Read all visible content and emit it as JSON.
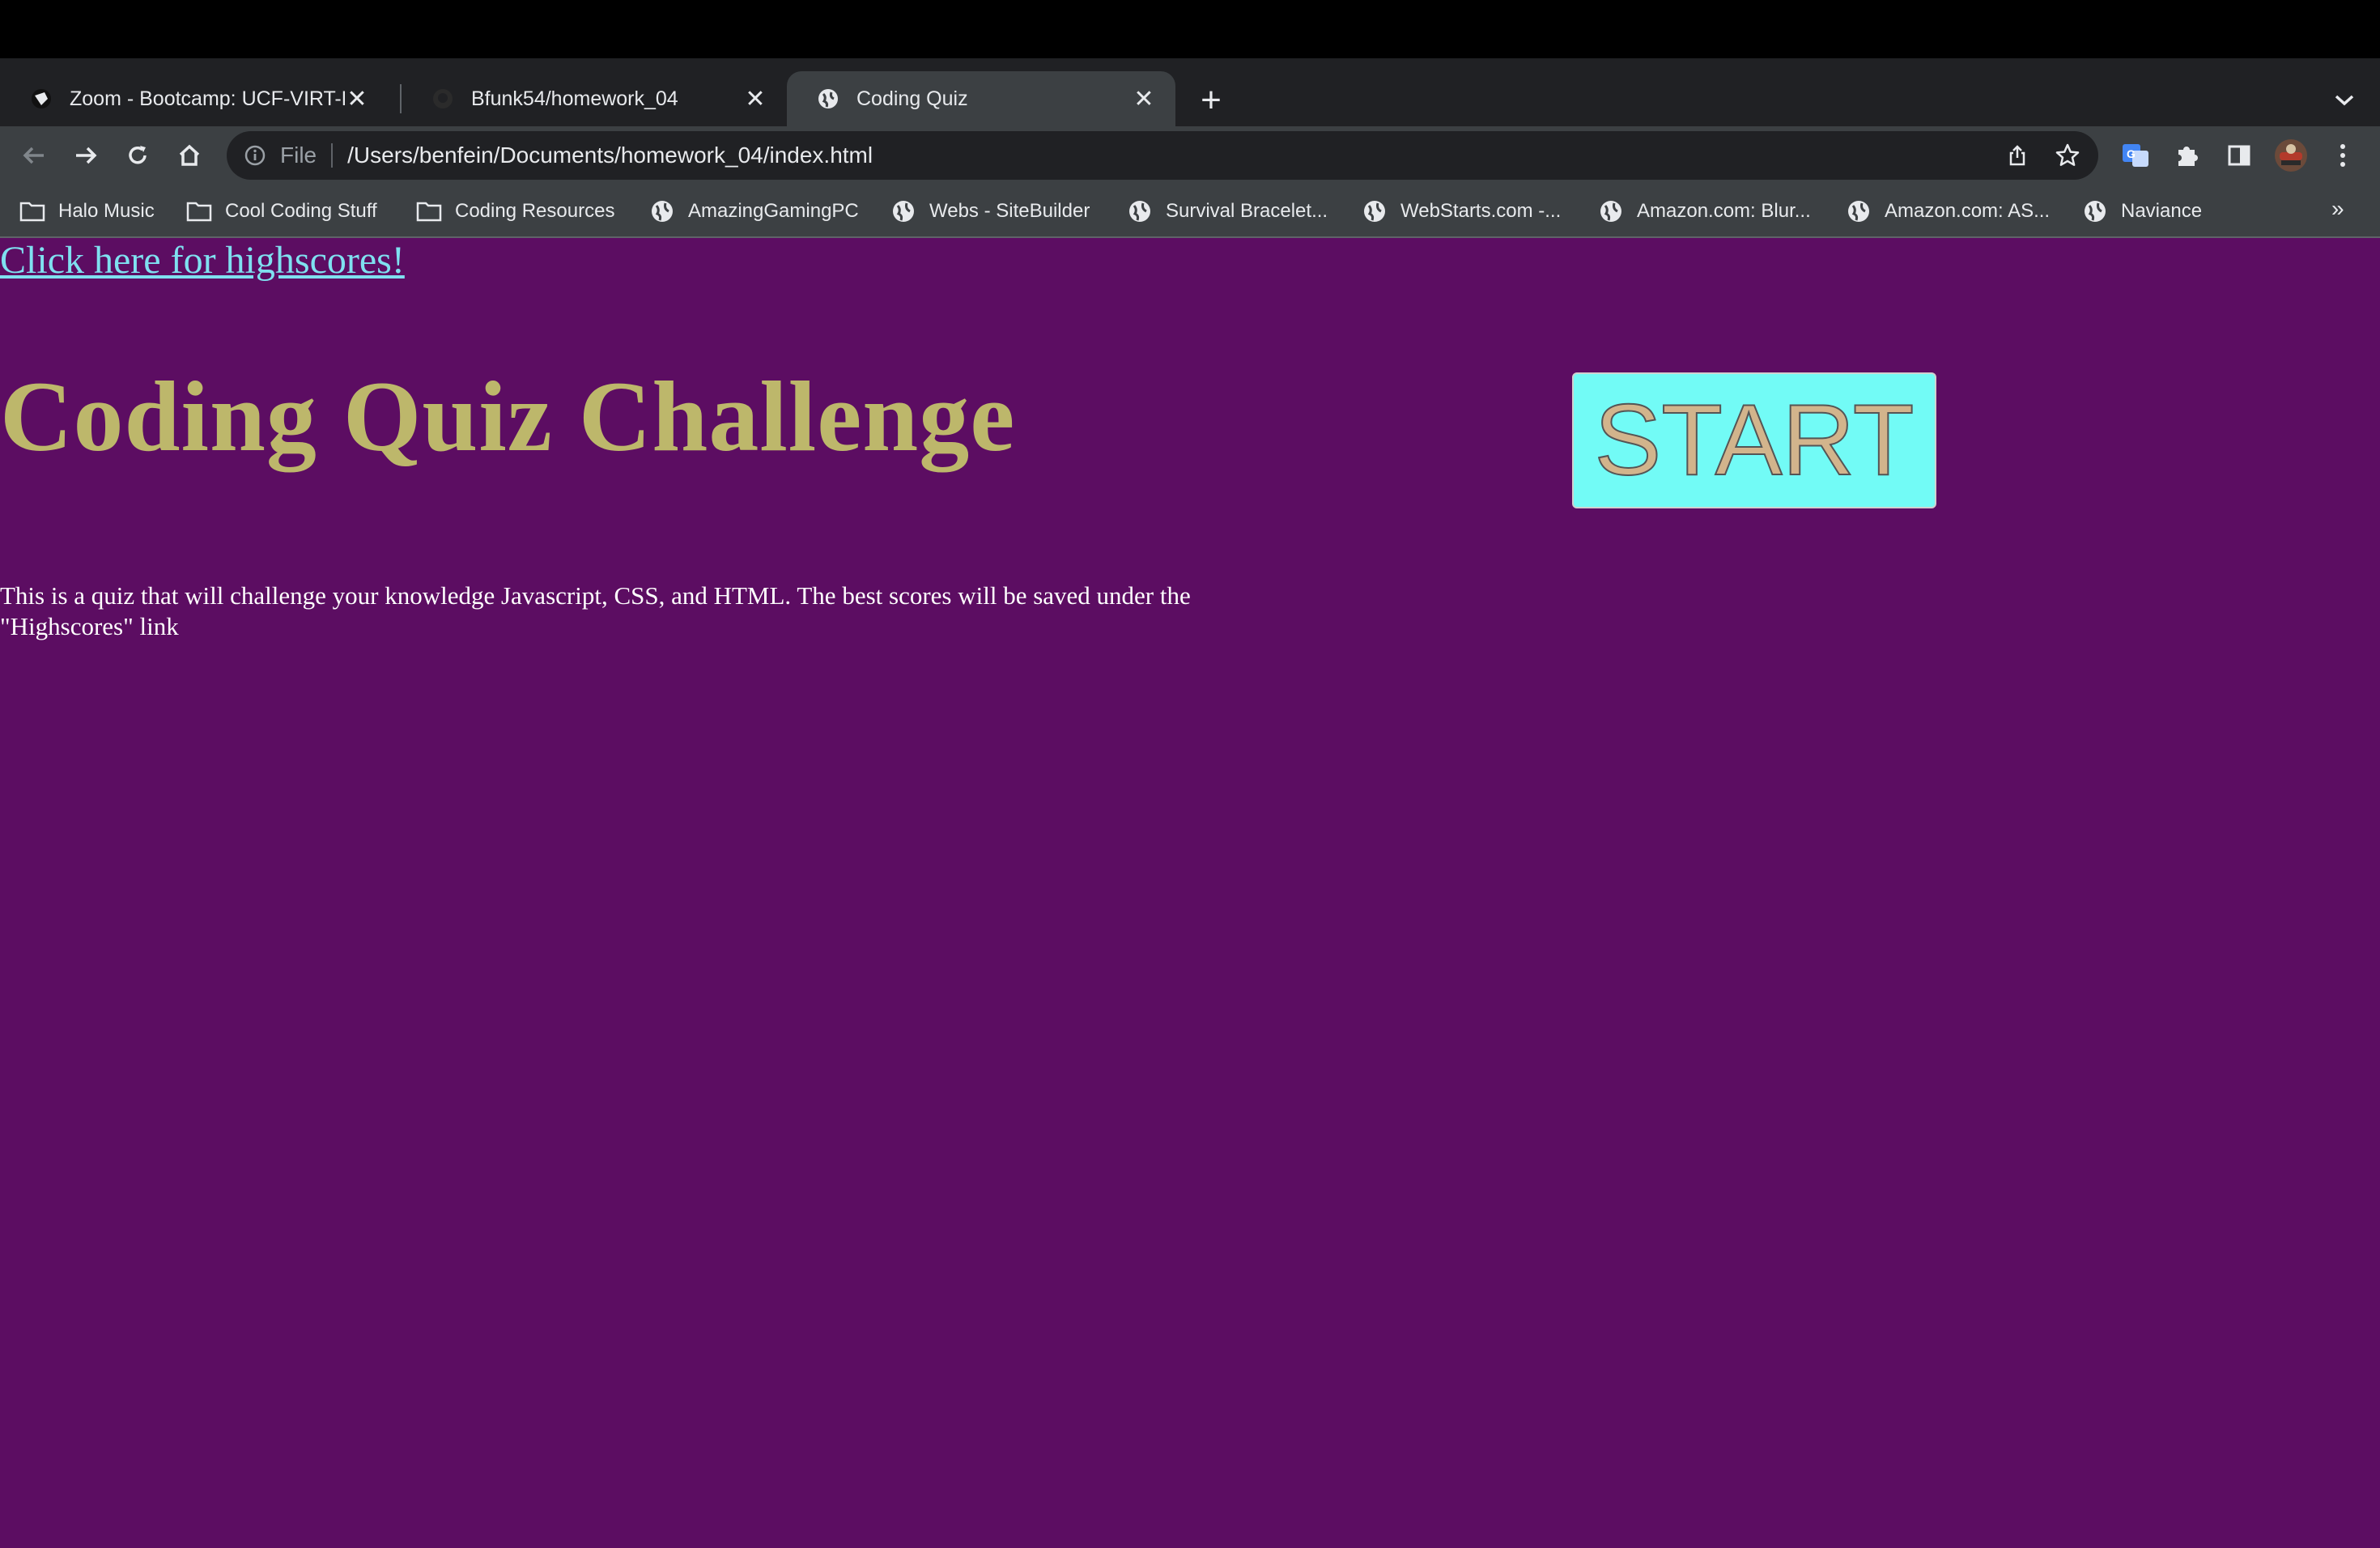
{
  "browser": {
    "tabs": [
      {
        "title": "Zoom - Bootcamp: UCF-VIRT-F",
        "icon": "zoom-icon",
        "active": false
      },
      {
        "title": "Bfunk54/homework_04",
        "icon": "github-icon",
        "active": false
      },
      {
        "title": "Coding Quiz",
        "icon": "globe-icon",
        "active": true
      }
    ],
    "close_glyph": "✕",
    "new_tab_glyph": "+",
    "omnibox": {
      "scheme": "File",
      "url": "/Users/benfein/Documents/homework_04/index.html"
    },
    "bookmarks": [
      {
        "label": "Halo Music",
        "icon": "folder-icon"
      },
      {
        "label": "Cool Coding Stuff",
        "icon": "folder-icon"
      },
      {
        "label": "Coding Resources",
        "icon": "folder-icon"
      },
      {
        "label": "AmazingGamingPC",
        "icon": "globe-icon"
      },
      {
        "label": "Webs - SiteBuilder",
        "icon": "globe-icon"
      },
      {
        "label": "Survival Bracelet...",
        "icon": "globe-icon"
      },
      {
        "label": "WebStarts.com -...",
        "icon": "globe-icon"
      },
      {
        "label": "Amazon.com: Blur...",
        "icon": "globe-icon"
      },
      {
        "label": "Amazon.com: AS...",
        "icon": "globe-icon"
      },
      {
        "label": "Naviance",
        "icon": "globe-icon"
      }
    ],
    "bookmarks_more": "»"
  },
  "page": {
    "highscores_link": "Click here for highscores!",
    "title": "Coding Quiz Challenge",
    "start_button": "START",
    "description": "This is a quiz that will challenge your knowledge Javascript, CSS, and HTML. The best scores will be saved under the \"Highscores\" link"
  },
  "colors": {
    "page_background": "#5c0d62",
    "title": "#bdb76b",
    "link": "#7fe0f0",
    "start_button_bg": "#72fbf6",
    "start_button_text": "#d2b48c"
  }
}
